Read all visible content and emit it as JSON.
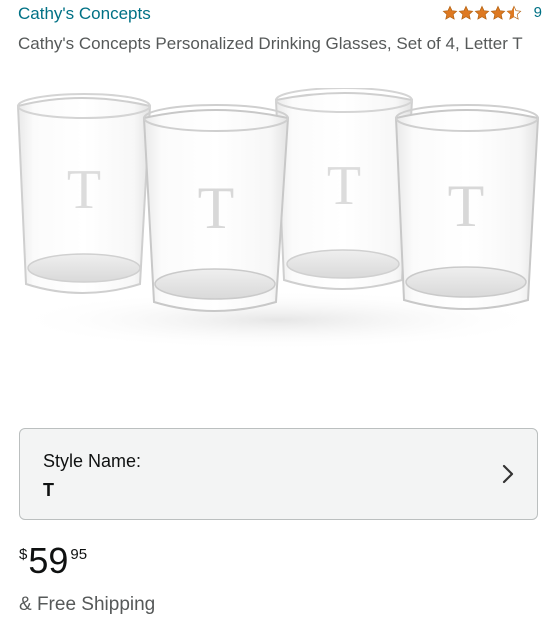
{
  "product": {
    "brand": "Cathy's Concepts",
    "title": "Cathy's Concepts Personalized Drinking Glasses, Set of 4, Letter T",
    "rating_stars": 4.5,
    "review_count": "9",
    "glass_letter": "T"
  },
  "variation": {
    "label": "Style Name:",
    "value": "T"
  },
  "price": {
    "symbol": "$",
    "whole": "59",
    "fraction": "95"
  },
  "shipping": "& Free Shipping",
  "colors": {
    "link": "#007185",
    "star": "#de7921",
    "secondary_text": "#565959"
  }
}
